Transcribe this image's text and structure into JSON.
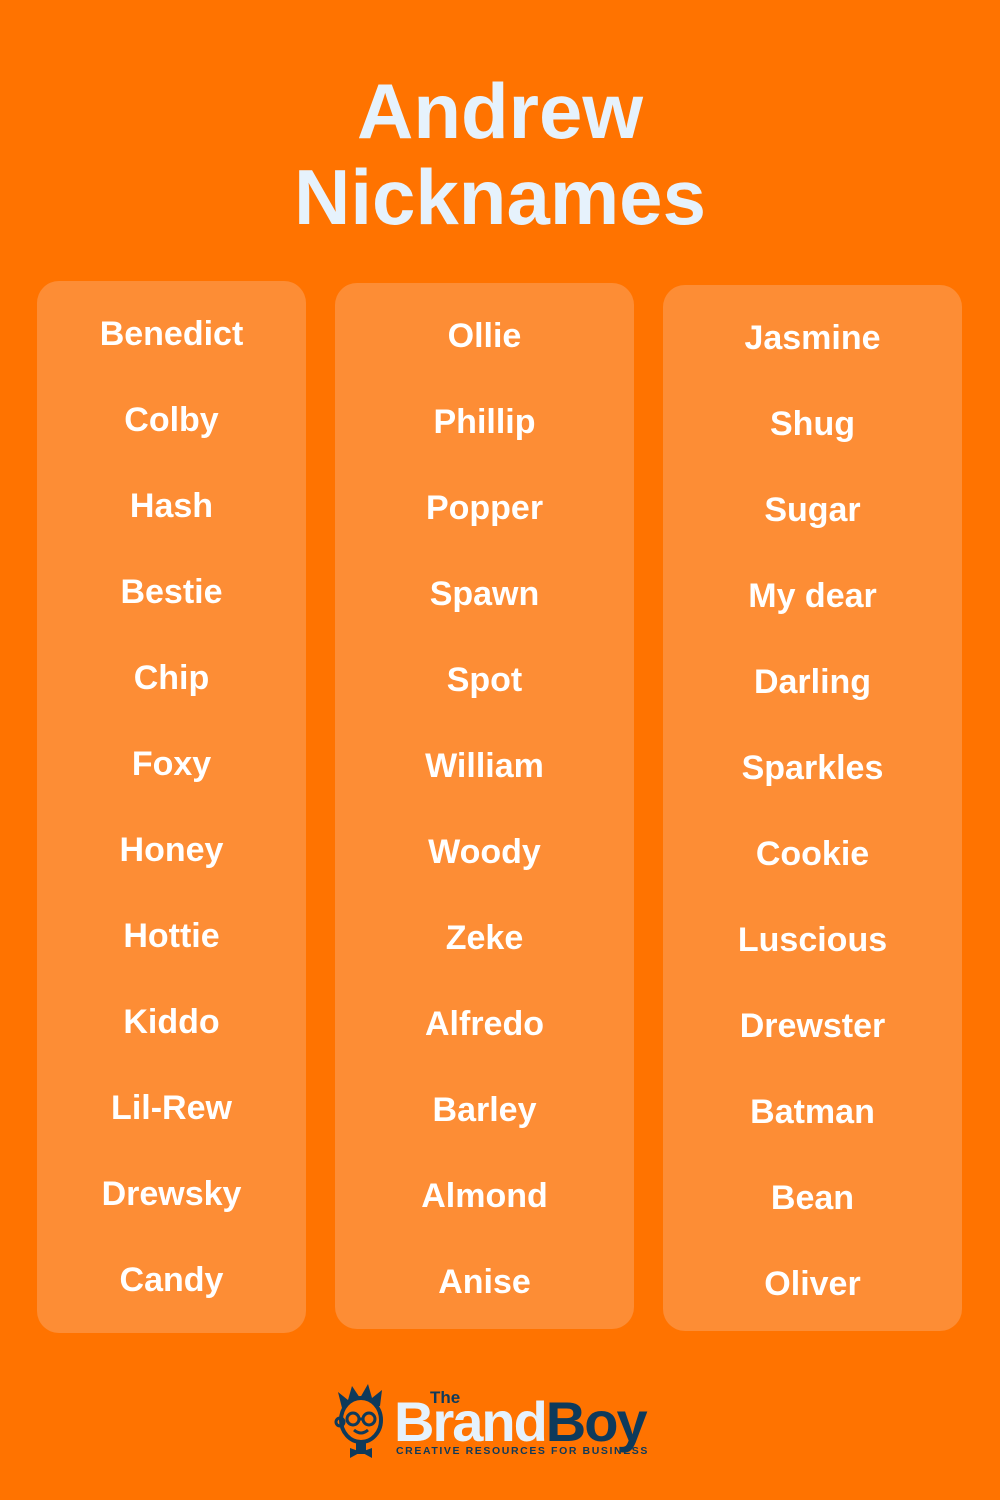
{
  "title": {
    "line1": "Andrew",
    "line2": "Nicknames"
  },
  "columns": [
    {
      "names": [
        "Benedict",
        "Colby",
        "Hash",
        "Bestie",
        "Chip",
        "Foxy",
        "Honey",
        "Hottie",
        "Kiddo",
        "Lil-Rew",
        "Drewsky",
        "Candy"
      ]
    },
    {
      "names": [
        "Ollie",
        "Phillip",
        "Popper",
        "Spawn",
        "Spot",
        "William",
        "Woody",
        "Zeke",
        "Alfredo",
        "Barley",
        "Almond",
        "Anise"
      ]
    },
    {
      "names": [
        "Jasmine",
        "Shug",
        "Sugar",
        "My dear",
        "Darling",
        "Sparkles",
        "Cookie",
        "Luscious",
        "Drewster",
        "Batman",
        "Bean",
        "Oliver"
      ]
    }
  ],
  "logo": {
    "the": "The",
    "brand_part1": "Brand",
    "brand_part2": "Boy",
    "tagline": "CREATIVE RESOURCES FOR BUSINESS",
    "mascot_icon": "boy-with-glasses-and-bowtie-icon"
  },
  "colors": {
    "background": "#FF7300",
    "panel": "#FD8D35",
    "title_text": "#E6F2FC",
    "name_text": "#FFFFFF",
    "logo_navy": "#0E3A5B"
  }
}
